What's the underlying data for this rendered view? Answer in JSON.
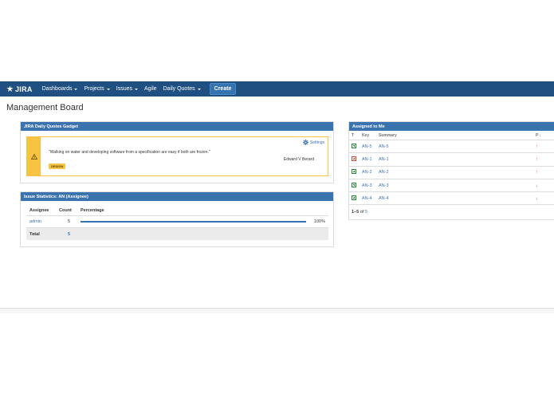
{
  "header": {
    "logo_text": "JIRA",
    "nav": [
      {
        "label": "Dashboards",
        "dropdown": true
      },
      {
        "label": "Projects",
        "dropdown": true
      },
      {
        "label": "Issues",
        "dropdown": true
      },
      {
        "label": "Agile",
        "dropdown": false
      },
      {
        "label": "Daily Quotes",
        "dropdown": true
      }
    ],
    "create_label": "Create",
    "bar_color": "#205081"
  },
  "page": {
    "title": "Management Board"
  },
  "quote_gadget": {
    "title": "JIRA Daily Quotes Gadget",
    "settings_label": "Settings",
    "quote": "\"Walking on water and developing software from a specification are easy if both are frozen.\"",
    "author": "Edward V Berard",
    "tag": "DESIGN",
    "warning_icon": "warning-icon",
    "accent_color": "#f6c342"
  },
  "stats_gadget": {
    "title": "Issue Statistics: AN (Assignee)",
    "columns": {
      "assignee": "Assignee",
      "count": "Count",
      "percentage": "Percentage"
    },
    "rows": [
      {
        "assignee": "admin",
        "count": "5",
        "percent": 100,
        "percent_label": "100%"
      }
    ],
    "total": {
      "label": "Total",
      "count": "5"
    }
  },
  "assigned_gadget": {
    "title": "Assigned to Me",
    "columns": {
      "type": "T",
      "key": "Key",
      "summary": "Summary",
      "priority": "P"
    },
    "rows": [
      {
        "type": "improvement",
        "key": "AN-5",
        "summary": "AN-5",
        "priority": "up",
        "priority_glyph": "↑",
        "priority_color": "#d04437"
      },
      {
        "type": "bug",
        "key": "AN-1",
        "summary": "AN-1",
        "priority": "up",
        "priority_glyph": "↑",
        "priority_color": "#d04437"
      },
      {
        "type": "improvement",
        "key": "AN-2",
        "summary": "AN-2",
        "priority": "up",
        "priority_glyph": "↑",
        "priority_color": "#d04437"
      },
      {
        "type": "improvement",
        "key": "AN-3",
        "summary": "AN-3",
        "priority": "down",
        "priority_glyph": "↓",
        "priority_color": "#14892c"
      },
      {
        "type": "improvement",
        "key": "AN-4",
        "summary": "AN-4",
        "priority": "down",
        "priority_glyph": "↓",
        "priority_color": "#14892c"
      }
    ],
    "footer": {
      "range": "1–5",
      "of": "of",
      "total": "5"
    }
  }
}
